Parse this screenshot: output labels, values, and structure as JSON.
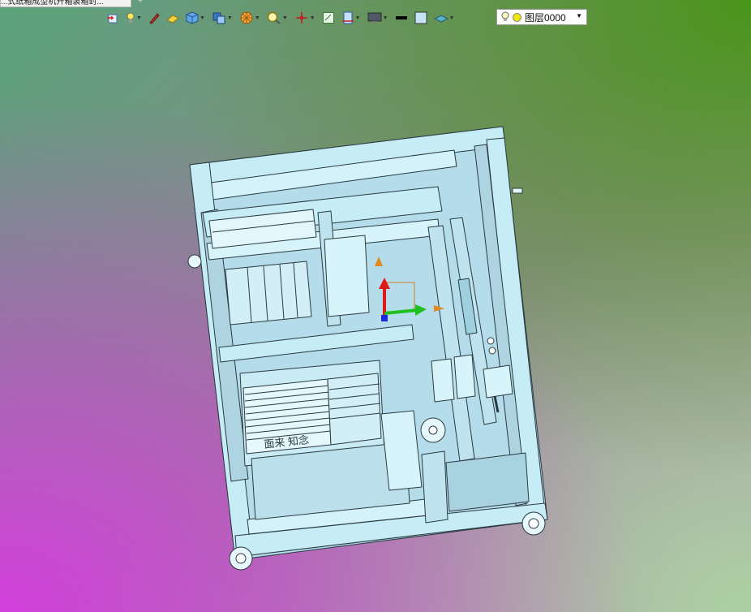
{
  "document_tab": {
    "title": "...式纸箱成型机开箱装箱封...",
    "add_label": "+"
  },
  "toolbar": {
    "buttons": [
      {
        "icon": "exit-sketch-icon",
        "dropdown": false
      },
      {
        "icon": "light-icon",
        "dropdown": true
      },
      {
        "icon": "pen-edit-icon",
        "dropdown": false
      },
      {
        "icon": "eraser-icon",
        "dropdown": false
      },
      {
        "icon": "cube-solid-icon",
        "dropdown": true
      },
      {
        "icon": "view-orientation-icon",
        "dropdown": true
      },
      {
        "icon": "render-style-icon",
        "dropdown": true
      },
      {
        "icon": "zoom-icon",
        "dropdown": true
      },
      {
        "icon": "triad-icon",
        "dropdown": true
      },
      {
        "icon": "frame-icon",
        "dropdown": false
      },
      {
        "icon": "section-icon",
        "dropdown": true
      },
      {
        "icon": "monitor-icon",
        "dropdown": true
      },
      {
        "icon": "line-color-icon",
        "dropdown": false
      },
      {
        "icon": "fill-color-icon",
        "dropdown": false
      },
      {
        "icon": "layer-display-icon",
        "dropdown": true
      }
    ],
    "layer_name": "图层0000"
  },
  "model": {
    "label_text": "面来 知念",
    "frame_color": "#c6ecf6",
    "edge_color": "#2a3a40"
  }
}
